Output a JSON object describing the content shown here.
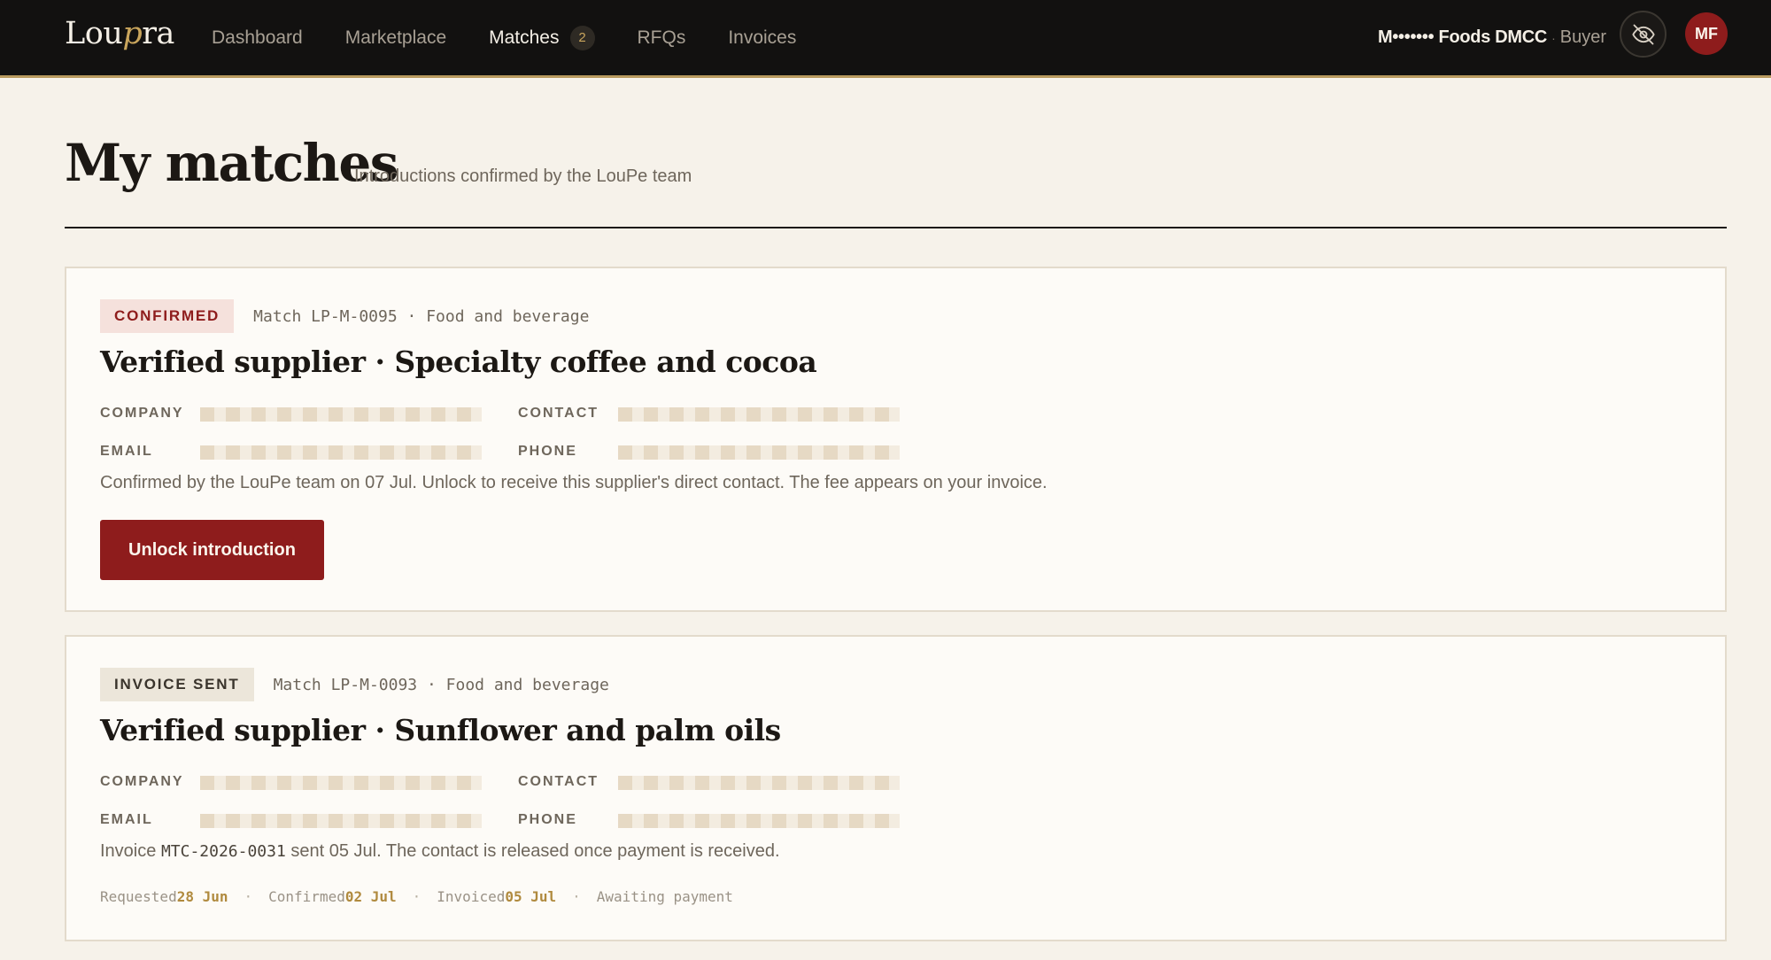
{
  "brand": {
    "name_start": "Lou",
    "name_accent": "p",
    "name_end": "ra"
  },
  "nav": {
    "dashboard": "Dashboard",
    "marketplace": "Marketplace",
    "matches": "Matches",
    "matches_count": "2",
    "rfqs": "RFQs",
    "invoices": "Invoices"
  },
  "account": {
    "org": "M••••••• Foods DMCC",
    "role": "Buyer",
    "initials": "MF"
  },
  "page": {
    "title": "My matches",
    "subtitle": "Introductions confirmed by the LouPe team"
  },
  "matches": [
    {
      "status": "CONFIRMED",
      "meta": "Match LP-M-0095 · Food and beverage",
      "title": "Verified supplier · Specialty coffee and cocoa",
      "labels": {
        "company": "COMPANY",
        "contact": "CONTACT",
        "email": "EMAIL",
        "phone": "PHONE"
      },
      "note": "Confirmed by the LouPe team on 07 Jul. Unlock to receive this supplier's direct contact. The fee appears on your invoice.",
      "action": "Unlock introduction"
    },
    {
      "status": "INVOICE SENT",
      "meta": "Match LP-M-0093 · Food and beverage",
      "title": "Verified supplier · Sunflower and palm oils",
      "labels": {
        "company": "COMPANY",
        "contact": "CONTACT",
        "email": "EMAIL",
        "phone": "PHONE"
      },
      "note_prefix": "Invoice ",
      "invoice_no": "MTC-2026-0031",
      "note_suffix": " sent 05 Jul. The contact is released once payment is received.",
      "timeline": {
        "requested_label": "Requested",
        "requested_date": "28 Jun",
        "confirmed_label": "Confirmed",
        "confirmed_date": "02 Jul",
        "invoiced_label": "Invoiced",
        "invoiced_date": "05 Jul",
        "state": "Awaiting payment"
      }
    }
  ],
  "colors": {
    "accent_red": "#8e1c1c",
    "gold": "#b89a5e",
    "nav_bg": "#121110",
    "page_bg": "#f6f2ea"
  },
  "icons": {
    "privacy_toggle": "eye-off-icon"
  }
}
